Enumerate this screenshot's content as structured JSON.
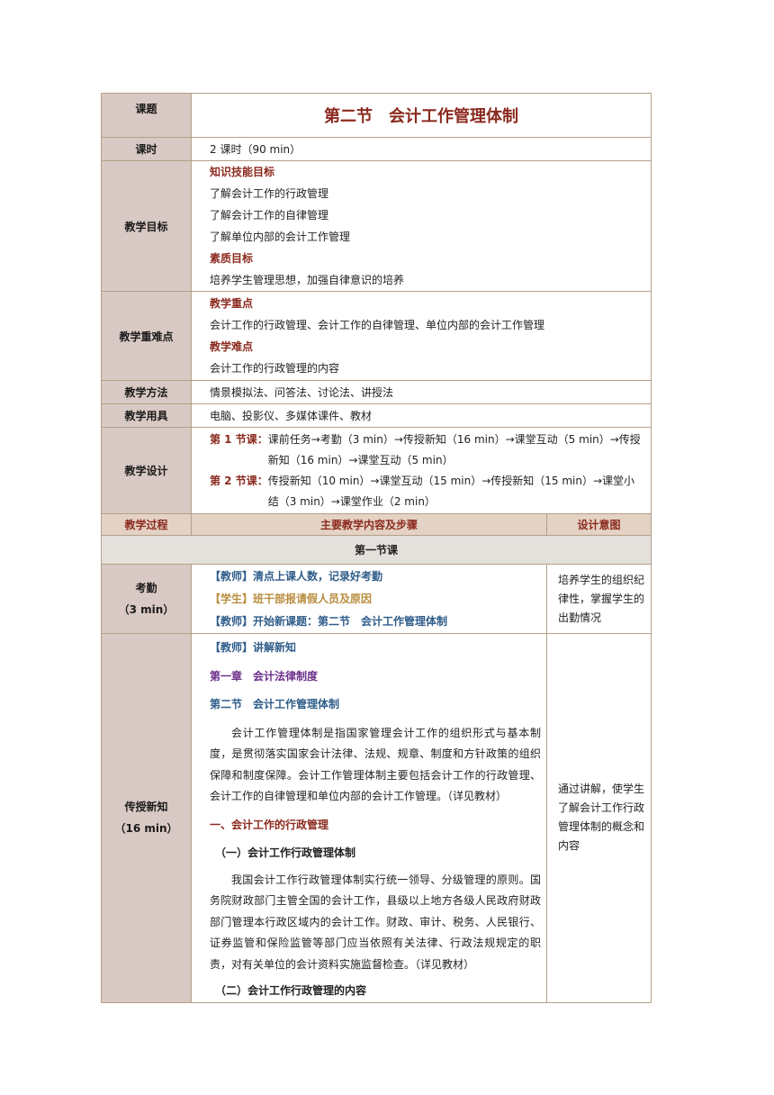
{
  "labels": {
    "topic": "课题",
    "hours": "课时",
    "objectives": "教学目标",
    "key_points": "教学重难点",
    "methods": "教学方法",
    "tools": "教学用具",
    "design": "教学设计"
  },
  "title": "第二节　会计工作管理体制",
  "hours_value": "2 课时（90 min）",
  "objectives": {
    "h1": "知识技能目标",
    "items": [
      "了解会计工作的行政管理",
      "了解会计工作的自律管理",
      "了解单位内部的会计工作管理"
    ],
    "h2": "素质目标",
    "quality": "培养学生管理思想，加强自律意识的培养"
  },
  "key_points": {
    "h1": "教学重点",
    "key": "会计工作的行政管理、会计工作的自律管理、单位内部的会计工作管理",
    "h2": "教学难点",
    "difficult": "会计工作的行政管理的内容"
  },
  "methods_value": "情景模拟法、问答法、讨论法、讲授法",
  "tools_value": "电脑、投影仪、多媒体课件、教材",
  "design": {
    "s1_label": "第 1 节课：",
    "s1": "课前任务→考勤（3 min）→传授新知（16 min）→课堂互动（5 min）→传授新知（16 min）→课堂互动（5 min）",
    "s2_label": "第 2 节课：",
    "s2": "传授新知（10 min）→课堂互动（15 min）→传授新知（15 min）→课堂小结（3 min）→课堂作业（2 min）"
  },
  "process_header": {
    "col1": "教学过程",
    "col2": "主要教学内容及步骤",
    "col3": "设计意图"
  },
  "section1": "第一节课",
  "attendance": {
    "label": "考勤",
    "time": "（3 min）",
    "l1": "【教师】清点上课人数，记录好考勤",
    "l2": "【学生】班干部报请假人员及原因",
    "l3": "【教师】开始新课题：第二节　会计工作管理体制",
    "intent": "培养学生的组织纪律性，掌握学生的出勤情况"
  },
  "teach": {
    "label": "传授新知",
    "time": "（16 min）",
    "l1": "【教师】讲解新知",
    "chapter": "第一章　会计法律制度",
    "section": "第二节　会计工作管理体制",
    "p1": "会计工作管理体制是指国家管理会计工作的组织形式与基本制度，是贯彻落实国家会计法律、法规、规章、制度和方针政策的组织保障和制度保障。会计工作管理体制主要包括会计工作的行政管理、会计工作的自律管理和单位内部的会计工作管理。（详见教材）",
    "h1": "一、会计工作的行政管理",
    "h1a": "（一）会计工作行政管理体制",
    "p2": "我国会计工作行政管理体制实行统一领导、分级管理的原则。国务院财政部门主管全国的会计工作，县级以上地方各级人民政府财政部门管理本行政区域内的会计工作。财政、审计、税务、人民银行、证券监管和保险监管等部门应当依照有关法律、行政法规规定的职责，对有关单位的会计资料实施监督检查。（详见教材）",
    "h1b": "（二）会计工作行政管理的内容",
    "intent": "通过讲解，使学生了解会计工作行政管理体制的概念和内容"
  }
}
